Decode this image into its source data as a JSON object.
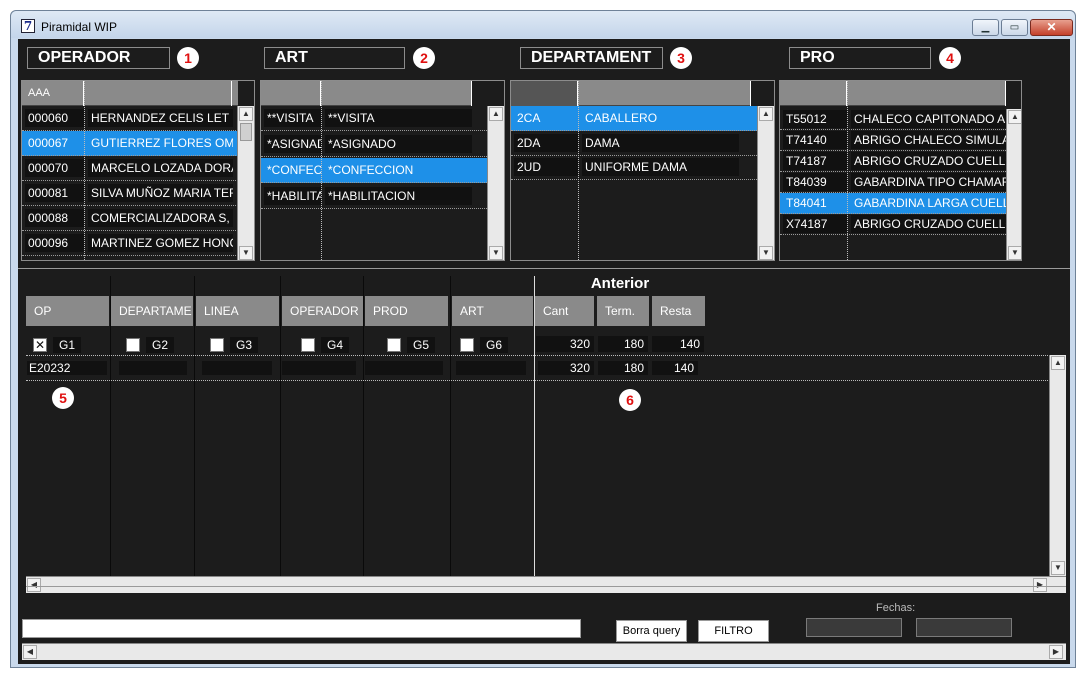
{
  "window": {
    "title": "Piramidal WIP",
    "icon_glyph": "7",
    "controls": {
      "minimize": "▁",
      "maximize": "▭",
      "close": "✕"
    }
  },
  "sections": [
    {
      "title": "OPERADOR",
      "badge": "1"
    },
    {
      "title": "ART",
      "badge": "2"
    },
    {
      "title": "DEPARTAMENT",
      "badge": "3"
    },
    {
      "title": "PRO",
      "badge": "4"
    }
  ],
  "operador": {
    "header": [
      "AAA",
      ""
    ],
    "rows": [
      {
        "code": "000060",
        "name": "HERNANDEZ CELIS LET"
      },
      {
        "code": "000067",
        "name": "GUTIERREZ FLORES OM"
      },
      {
        "code": "000070",
        "name": "MARCELO LOZADA DORA"
      },
      {
        "code": "000081",
        "name": "SILVA MUÑOZ MARIA TER"
      },
      {
        "code": "000088",
        "name": "COMERCIALIZADORA S,"
      },
      {
        "code": "000096",
        "name": "MARTINEZ GOMEZ HONC"
      }
    ],
    "selected_index": 1
  },
  "art": {
    "header": [
      "",
      ""
    ],
    "rows": [
      {
        "code": "**VISITA",
        "name": "**VISITA"
      },
      {
        "code": "*ASIGNAD",
        "name": "*ASIGNADO"
      },
      {
        "code": "*CONFEC",
        "name": "*CONFECCION"
      },
      {
        "code": "*HABILITA",
        "name": "*HABILITACION"
      }
    ],
    "selected_index": 2
  },
  "departament": {
    "header": [
      "",
      ""
    ],
    "rows": [
      {
        "code": "2CA",
        "name": "CABALLERO"
      },
      {
        "code": "2DA",
        "name": "DAMA"
      },
      {
        "code": "2UD",
        "name": "UNIFORME DAMA"
      }
    ],
    "selected_index": 0
  },
  "pro": {
    "header": [
      "",
      ""
    ],
    "rows": [
      {
        "code": "T55012",
        "name": "CHALECO CAPITONADO AL"
      },
      {
        "code": "T74140",
        "name": "ABRIGO CHALECO SIMULAD"
      },
      {
        "code": "T74187",
        "name": "ABRIGO CRUZADO CUELLO"
      },
      {
        "code": "T84039",
        "name": "GABARDINA TIPO CHAMARR"
      },
      {
        "code": "T84041",
        "name": "GABARDINA LARGA CUELLO"
      },
      {
        "code": "X74187",
        "name": "ABRIGO CRUZADO CUELLO"
      }
    ],
    "selected_index": 4
  },
  "lower": {
    "anterior_label": "Anterior",
    "columns": [
      "OP",
      "DEPARTAME",
      "LINEA",
      "OPERADOR",
      "PROD",
      "ART"
    ],
    "num_columns": [
      "Cant",
      "Term.",
      "Resta"
    ],
    "groups": [
      {
        "label": "G1",
        "checked": true
      },
      {
        "label": "G2",
        "checked": false
      },
      {
        "label": "G3",
        "checked": false
      },
      {
        "label": "G4",
        "checked": false
      },
      {
        "label": "G5",
        "checked": false
      },
      {
        "label": "G6",
        "checked": false
      }
    ],
    "totals": {
      "cant": "320",
      "term": "180",
      "resta": "140"
    },
    "row": {
      "op": "E20232",
      "cant": "320",
      "term": "180",
      "resta": "140"
    },
    "badge_left": "5",
    "badge_right": "6"
  },
  "footer": {
    "borra_query": "Borra query",
    "filtro": "FILTRO",
    "fechas_label": "Fechas:"
  },
  "colors": {
    "selection": "#1e90e8",
    "background": "#1c1c1c",
    "header_gray": "#8a8a8a",
    "badge_red": "#e01010"
  }
}
